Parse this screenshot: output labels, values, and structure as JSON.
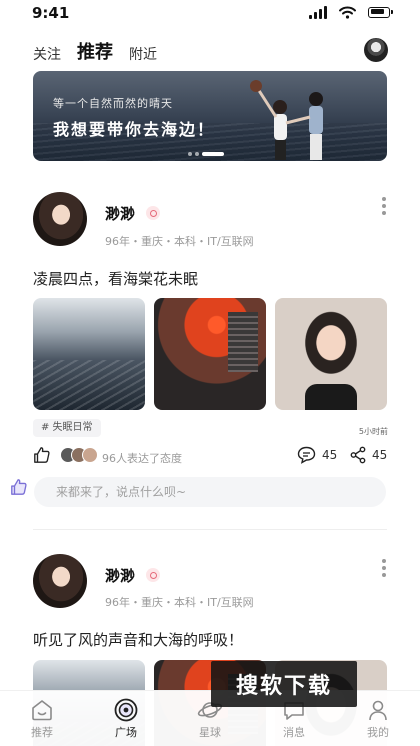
{
  "status_bar": {
    "time": "9:41"
  },
  "top_tabs": [
    {
      "label": "关注",
      "active": false
    },
    {
      "label": "推荐",
      "active": true
    },
    {
      "label": "附近",
      "active": false
    }
  ],
  "banner": {
    "line1": "等一个自然而然的晴天",
    "line2": "我想要带你去海边！",
    "page_count": 3,
    "active_page": 3
  },
  "posts": [
    {
      "name": "渺渺",
      "meta": "96年・重庆・本科・IT/互联网",
      "text": "凌晨四点，看海棠花未眠",
      "photos": [
        "city-dusk-photo",
        "sunset-window-photo",
        "laughing-girl-photo"
      ],
      "topic": "# 失眠日常",
      "time": "5小时前",
      "reactions_text": "96人表达了态度",
      "comment_count": "45",
      "share_count": "45",
      "comment_placeholder": "来都来了，说点什么呗~"
    },
    {
      "name": "渺渺",
      "meta": "96年・重庆・本科・IT/互联网",
      "text": "听见了风的声音和大海的呼吸！"
    }
  ],
  "watermark": "搜软下载",
  "bottom_nav": [
    {
      "label": "推荐",
      "icon": "home-icon",
      "active": false
    },
    {
      "label": "广场",
      "icon": "plaza-icon",
      "active": true
    },
    {
      "label": "星球",
      "icon": "planet-icon",
      "active": false
    },
    {
      "label": "消息",
      "icon": "message-icon",
      "active": false
    },
    {
      "label": "我的",
      "icon": "profile-icon",
      "active": false
    }
  ],
  "colors": {
    "accent_pink": "#e56a7a",
    "text_primary": "#222222",
    "text_muted": "#9a9a9a",
    "input_bg": "#f4f5f7"
  }
}
